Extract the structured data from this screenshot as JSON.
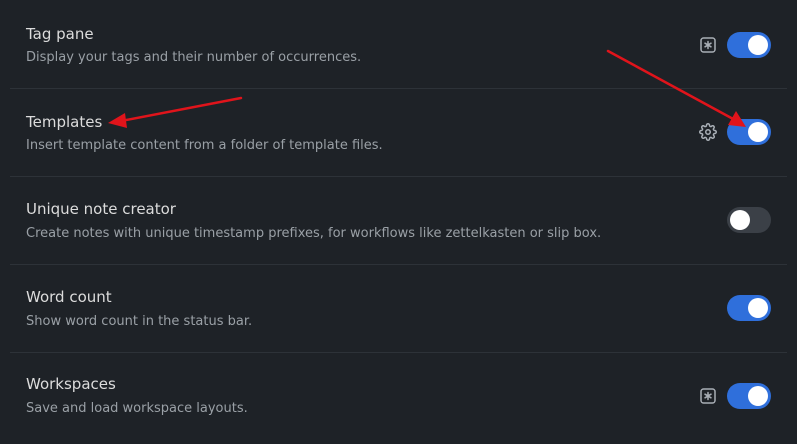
{
  "settings": [
    {
      "name": "Tag pane",
      "description": "Display your tags and their number of occurrences.",
      "extra_icon": "hotkey-icon",
      "enabled": true
    },
    {
      "name": "Templates",
      "description": "Insert template content from a folder of template files.",
      "extra_icon": "gear-icon",
      "enabled": true
    },
    {
      "name": "Unique note creator",
      "description": "Create notes with unique timestamp prefixes, for workflows like zettelkasten or slip box.",
      "extra_icon": null,
      "enabled": false
    },
    {
      "name": "Word count",
      "description": "Show word count in the status bar.",
      "extra_icon": null,
      "enabled": true
    },
    {
      "name": "Workspaces",
      "description": "Save and load workspace layouts.",
      "extra_icon": "hotkey-icon",
      "enabled": true
    }
  ],
  "colors": {
    "background": "#1e2227",
    "toggle_on": "#2f6fdb",
    "toggle_off": "#3b4047",
    "annotation_arrow": "#e0141b"
  }
}
